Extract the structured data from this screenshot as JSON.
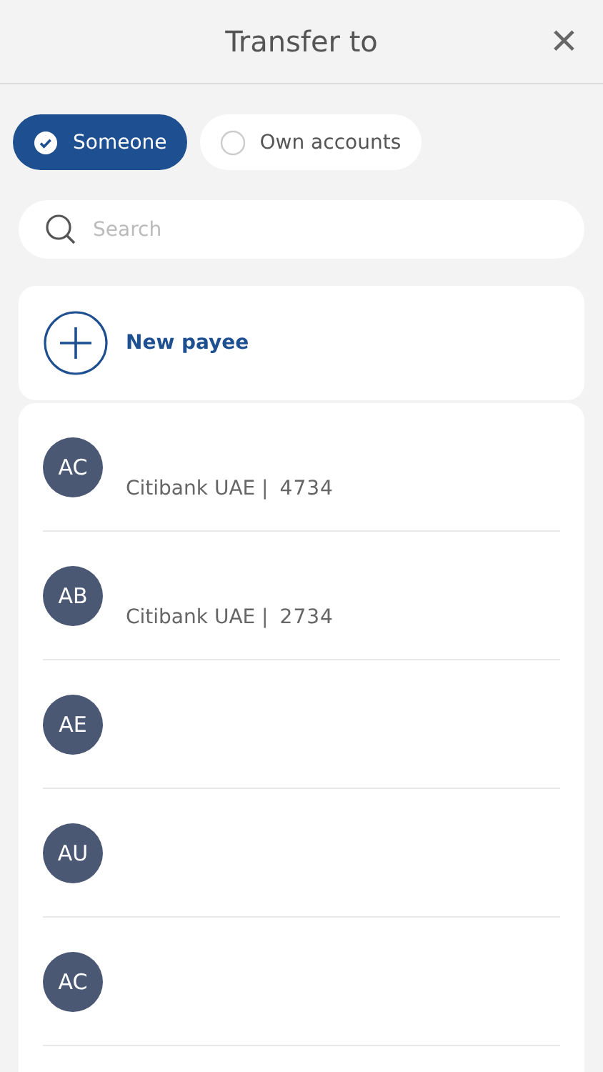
{
  "header": {
    "title": "Transfer to",
    "close": "×"
  },
  "filters": [
    {
      "label": "Someone",
      "selected": true
    },
    {
      "label": "Own accounts",
      "selected": false
    }
  ],
  "search": {
    "placeholder": "Search"
  },
  "new_payee": {
    "label": "New payee"
  },
  "payees": [
    {
      "initials": "AC",
      "bank": "Citibank UAE |",
      "account": "4734"
    },
    {
      "initials": "AB",
      "bank": "Citibank UAE |",
      "account": "2734"
    },
    {
      "initials": "AE"
    },
    {
      "initials": "AU"
    },
    {
      "initials": "AC"
    }
  ]
}
